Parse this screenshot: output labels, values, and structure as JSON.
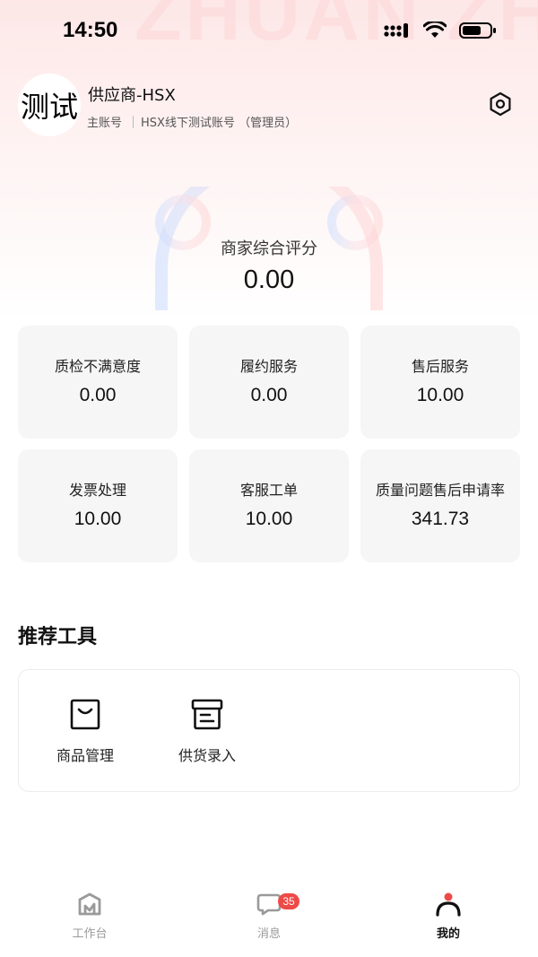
{
  "status_bar": {
    "time": "14:50"
  },
  "background": {
    "watermark": "ZHUAN ZHUAN"
  },
  "profile": {
    "avatar_text": "测试",
    "store_name": "供应商-HSX",
    "account_type": "主账号",
    "account_detail": "HSX线下测试账号 （管理员）"
  },
  "score": {
    "label": "商家综合评分",
    "value": "0.00"
  },
  "metrics": [
    {
      "label": "质检不满意度",
      "value": "0.00"
    },
    {
      "label": "履约服务",
      "value": "0.00"
    },
    {
      "label": "售后服务",
      "value": "10.00"
    },
    {
      "label": "发票处理",
      "value": "10.00"
    },
    {
      "label": "客服工单",
      "value": "10.00"
    },
    {
      "label": "质量问题售后申请率",
      "value": "341.73"
    }
  ],
  "tools": {
    "title": "推荐工具",
    "items": [
      {
        "label": "商品管理",
        "icon": "shopping-bag-icon"
      },
      {
        "label": "供货录入",
        "icon": "archive-box-icon"
      }
    ]
  },
  "tab_bar": {
    "items": [
      {
        "label": "工作台",
        "icon": "workbench-icon"
      },
      {
        "label": "消息",
        "icon": "chat-bubble-icon",
        "badge": "35"
      },
      {
        "label": "我的",
        "icon": "profile-icon",
        "active": true
      }
    ]
  },
  "colors": {
    "accent": "#ee4a48",
    "card_bg": "#f6f6f6",
    "header_tint": "#fde7e7"
  }
}
